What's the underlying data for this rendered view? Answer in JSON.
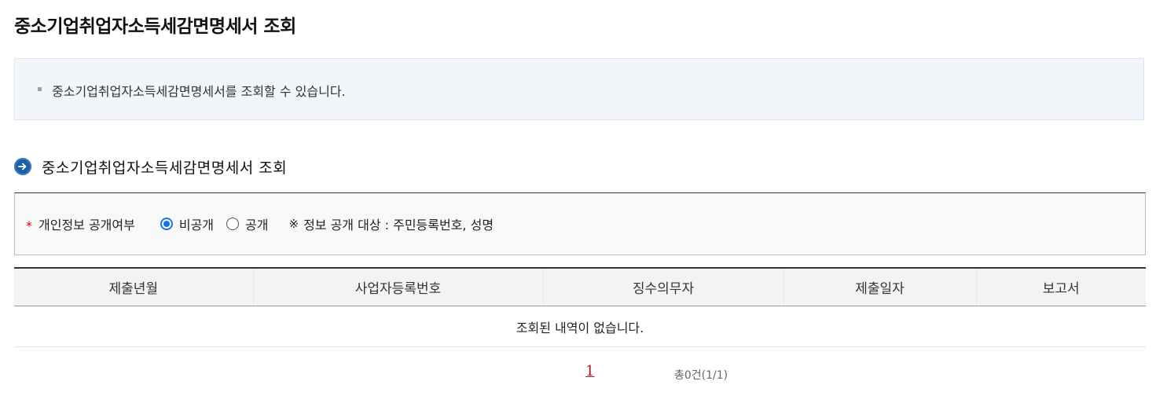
{
  "page": {
    "title": "중소기업취업자소득세감면명세서 조회"
  },
  "info": {
    "text": "중소기업취업자소득세감면명세서를 조회할 수 있습니다."
  },
  "section": {
    "title": "중소기업취업자소득세감면명세서 조회",
    "icon": "arrow-right-circle-icon",
    "icon_color": "#1f5fa8"
  },
  "filter": {
    "required_mark": "*",
    "label": "개인정보 공개여부",
    "options": [
      {
        "label": "비공개",
        "checked": true
      },
      {
        "label": "공개",
        "checked": false
      }
    ],
    "note_mark": "※",
    "note": "정보 공개 대상 : 주민등록번호, 성명"
  },
  "table": {
    "columns": [
      "제출년월",
      "사업자등록번호",
      "징수의무자",
      "제출일자",
      "보고서"
    ],
    "empty_message": "조회된 내역이 없습니다."
  },
  "pagination": {
    "current_page": "1",
    "total": "총0건(1/1)"
  },
  "colors": {
    "accent": "#1a73e8",
    "required": "#d0021b",
    "page_link": "#b1141c",
    "info_bg": "#f2f5fa"
  }
}
